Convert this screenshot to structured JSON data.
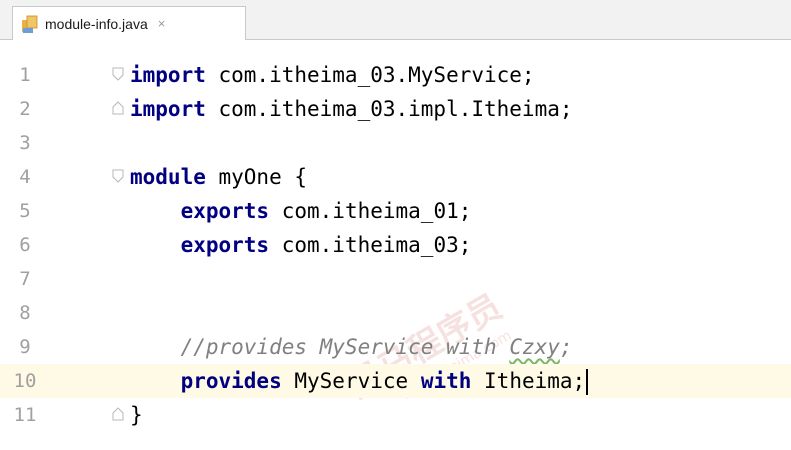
{
  "tab": {
    "label": "module-info.java",
    "close": "×"
  },
  "lines": [
    {
      "n": "1",
      "tokens": [
        [
          "kw",
          "import"
        ],
        [
          "text",
          " com.itheima_03.MyService;"
        ]
      ]
    },
    {
      "n": "2",
      "tokens": [
        [
          "kw",
          "import"
        ],
        [
          "text",
          " com.itheima_03.impl.Itheima;"
        ]
      ]
    },
    {
      "n": "3",
      "tokens": []
    },
    {
      "n": "4",
      "tokens": [
        [
          "kw",
          "module"
        ],
        [
          "text",
          " myOne {"
        ]
      ]
    },
    {
      "n": "5",
      "tokens": [
        [
          "text",
          "    "
        ],
        [
          "kw",
          "exports"
        ],
        [
          "text",
          " com.itheima_01;"
        ]
      ]
    },
    {
      "n": "6",
      "tokens": [
        [
          "text",
          "    "
        ],
        [
          "kw",
          "exports"
        ],
        [
          "text",
          " com.itheima_03;"
        ]
      ]
    },
    {
      "n": "7",
      "tokens": []
    },
    {
      "n": "8",
      "tokens": []
    },
    {
      "n": "9",
      "tokens": [
        [
          "text",
          "    "
        ],
        [
          "comment",
          "//provides MyService with "
        ],
        [
          "typo",
          "Czxy"
        ],
        [
          "comment",
          ";"
        ]
      ]
    },
    {
      "n": "10",
      "tokens": [
        [
          "text",
          "    "
        ],
        [
          "kw",
          "provides"
        ],
        [
          "text",
          " MyService "
        ],
        [
          "kw",
          "with"
        ],
        [
          "text",
          " Itheima;"
        ]
      ]
    },
    {
      "n": "11",
      "tokens": [
        [
          "text",
          "}"
        ]
      ]
    }
  ],
  "current_line": "10",
  "watermark": {
    "cn": "黑马程序员",
    "site": "www.itheima.com"
  },
  "colors": {
    "keyword": "#000080",
    "comment": "#808080",
    "current_line": "#fefae6"
  }
}
